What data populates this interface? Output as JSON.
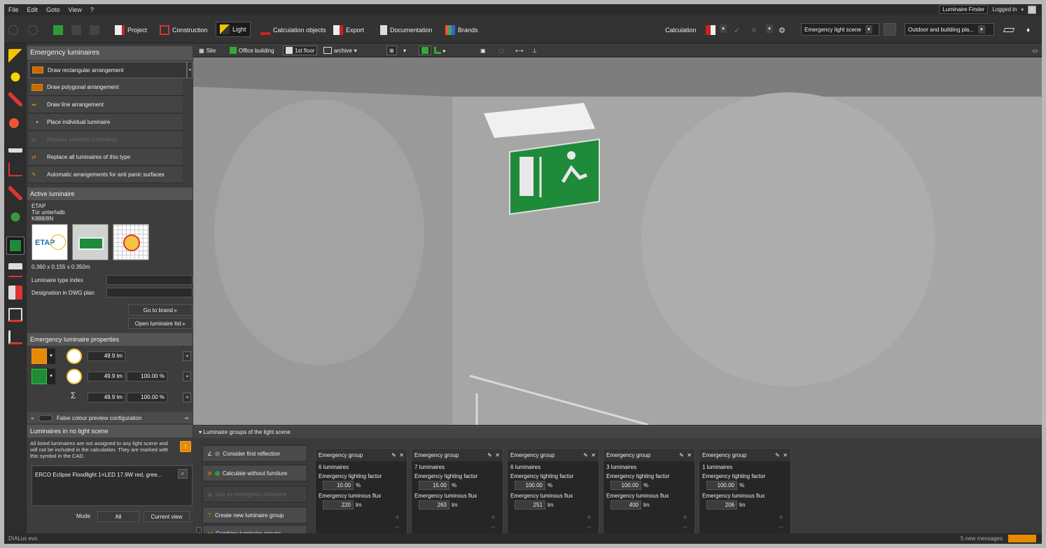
{
  "menubar": {
    "items": [
      "File",
      "Edit",
      "Goto",
      "View",
      "?"
    ],
    "luminaire_finder": "Luminaire Finder",
    "logged_in": "Logged in"
  },
  "toolbar": {
    "tabs": [
      "Project",
      "Construction",
      "Light",
      "Calculation objects",
      "Export",
      "Documentation",
      "Brands"
    ],
    "calculation_label": "Calculation",
    "light_scene": "Emergency light scene",
    "outdoor": "Outdoor and building pla..."
  },
  "panel": {
    "emergency_title": "Emergency luminaires",
    "actions": [
      "Draw rectangular arrangement",
      "Draw polygonal arrangement",
      "Draw line arrangement",
      "Place individual luminaire",
      "Replace selected luminaires",
      "Replace all luminaires of this type",
      "Automatic arrangements for anti panic surfaces"
    ],
    "active_title": "Active luminaire",
    "manufacturer": "ETAP",
    "name": "Tür unterhalb",
    "code": "K888/8N",
    "etap_logo": "ETAP",
    "dimensions": "0.360 x 0.155 x 0.350m",
    "type_index_label": "Luminaire type index",
    "dwg_label": "Designation in DWG plan",
    "go_to_brand": "Go to brand",
    "open_list": "Open luminaire list",
    "props_title": "Emergency luminaire properties",
    "flux1": "49.9",
    "flux2": "49.9",
    "pct2": "100.00",
    "sum_flux": "49.9",
    "sum_pct": "100.00",
    "unit_lm": "lm",
    "unit_pct": "%",
    "sigma": "Σ",
    "false_colour": "False colour preview configuration",
    "no_scene_title": "Luminaires in no light scene",
    "no_scene_text": "All listed luminaires are not assigned to any light scene and will not be included in the calculation. They are marked with this symbol in the CAD.",
    "listed": "ERCO Eclipse Floodlight 1×LED 17.9W red, gree...",
    "mode_label": "Mode",
    "mode_all": "All",
    "mode_current": "Current view"
  },
  "viewport": {
    "site": "Site",
    "building": "Office building",
    "floor": "1st floor",
    "archive": "archive"
  },
  "bottom": {
    "title": "Luminaire groups of the light scene",
    "consider": "Consider first reflection",
    "calc_without": "Calculate without furniture",
    "use_as": "Use as emergency luminaire",
    "create": "Create new luminaire group",
    "combine": "Combine luminaire groups",
    "factor_label": "Emergency lighting factor",
    "flux_label": "Emergency luminous flux",
    "groups": [
      {
        "name": "Emergency group",
        "lum": "6 luminaires",
        "factor": "10.00",
        "flux": "220"
      },
      {
        "name": "Emergency group",
        "lum": "7 luminaires",
        "factor": "15.00",
        "flux": "263"
      },
      {
        "name": "Emergency group",
        "lum": "6 luminaires",
        "factor": "100.00",
        "flux": "251"
      },
      {
        "name": "Emergency group",
        "lum": "3 luminaires",
        "factor": "100.00",
        "flux": "400"
      },
      {
        "name": "Emergency group",
        "lum": "1 luminaires",
        "factor": "100.00",
        "flux": "206"
      }
    ]
  },
  "statusbar": {
    "app": "DIALux evo",
    "messages": "5 new messages"
  },
  "colors": {
    "accent_orange": "#e68a00",
    "emergency_green": "#1e8a3a"
  }
}
